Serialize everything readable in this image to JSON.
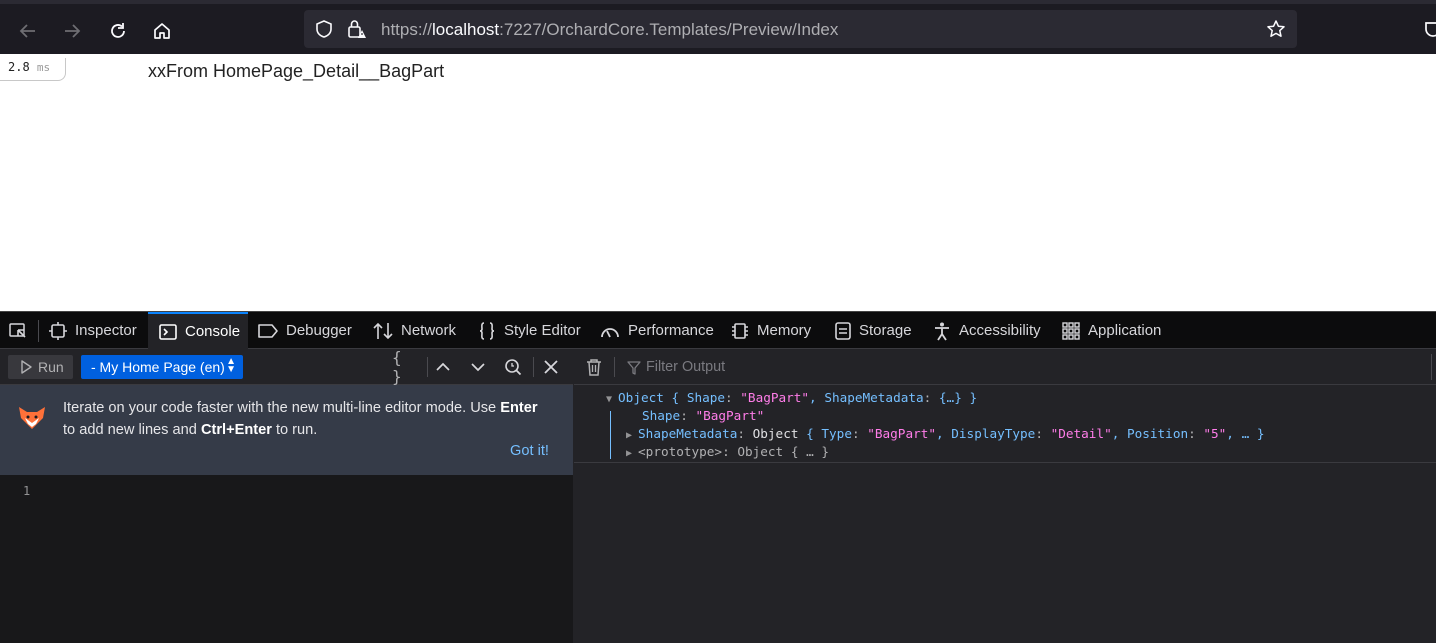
{
  "browser": {
    "url_scheme": "https://",
    "url_host": "localhost",
    "url_path": ":7227/OrchardCore.Templates/Preview/Index"
  },
  "page": {
    "timer_value": "2.8",
    "timer_unit": "ms",
    "body_text": "xxFrom HomePage_Detail__BagPart"
  },
  "devtools": {
    "tabs": [
      {
        "label": "Inspector"
      },
      {
        "label": "Console"
      },
      {
        "label": "Debugger"
      },
      {
        "label": "Network"
      },
      {
        "label": "Style Editor"
      },
      {
        "label": "Performance"
      },
      {
        "label": "Memory"
      },
      {
        "label": "Storage"
      },
      {
        "label": "Accessibility"
      },
      {
        "label": "Application"
      }
    ],
    "active_tab": "Console",
    "accent_color": "#0a84ff",
    "editor": {
      "run_label": "Run",
      "context_select": "- My Home Page (en)",
      "braces_label": "{ }",
      "line_number": "1"
    },
    "notice": {
      "text_1": "Iterate on your code faster with the new multi-line editor mode. Use ",
      "key_1": "Enter",
      "text_2": "to add new lines and ",
      "key_2": "Ctrl+Enter",
      "text_3": " to run.",
      "got_it": "Got it!"
    },
    "filter_placeholder": "Filter Output",
    "output": {
      "line1_obj": "Object",
      "line1_open": " { ",
      "line1_k1": "Shape",
      "line1_sep1": ": ",
      "line1_v1": "\"BagPart\"",
      "line1_comma": ", ",
      "line1_k2": "ShapeMetadata",
      "line1_sep2": ": ",
      "line1_v2": "{…}",
      "line1_close": " }",
      "line2_key": "Shape",
      "line2_sep": ": ",
      "line2_val": "\"BagPart\"",
      "line3_key": "ShapeMetadata",
      "line3_sep": ": ",
      "line3_obj": "Object",
      "line3_open": " { ",
      "line3_k1": "Type",
      "line3_v1": "\"BagPart\"",
      "line3_k2": "DisplayType",
      "line3_v2": "\"Detail\"",
      "line3_k3": "Position",
      "line3_v3": "\"5\"",
      "line3_tail": ", … }",
      "line4_key": "<prototype>",
      "line4_sep": ": ",
      "line4_val": "Object { … }"
    }
  }
}
